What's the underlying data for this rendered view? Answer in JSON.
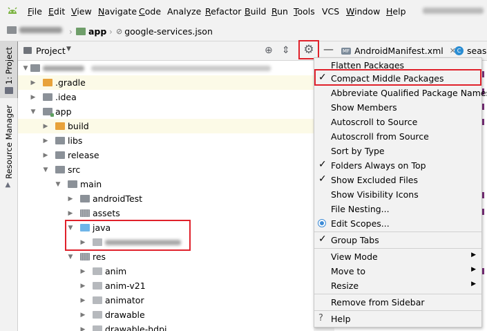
{
  "menubar": {
    "items": [
      {
        "label": "File",
        "u": "F",
        "rest": "ile"
      },
      {
        "label": "Edit",
        "u": "E",
        "rest": "dit"
      },
      {
        "label": "View",
        "u": "V",
        "rest": "iew"
      },
      {
        "label": "Navigate",
        "u": "N",
        "rest": "avigate"
      },
      {
        "label": "Code",
        "u": "C",
        "rest": "ode"
      },
      {
        "label": "Analyze",
        "u": "",
        "rest": "Analyze"
      },
      {
        "label": "Refactor",
        "u": "R",
        "rest": "efactor"
      },
      {
        "label": "Build",
        "u": "B",
        "rest": "uild"
      },
      {
        "label": "Run",
        "u": "R",
        "rest": "un"
      },
      {
        "label": "Tools",
        "u": "T",
        "rest": "ools"
      },
      {
        "label": "VCS",
        "u": "",
        "rest": "VCS"
      },
      {
        "label": "Window",
        "u": "W",
        "rest": "indow"
      },
      {
        "label": "Help",
        "u": "H",
        "rest": "elp"
      }
    ]
  },
  "breadcrumb": {
    "module": "app",
    "file": "google-services.json"
  },
  "sidebar": {
    "project_tab": "1: Project",
    "resource_tab": "Resource Manager"
  },
  "project_panel": {
    "title": "Project"
  },
  "editor_tabs": [
    {
      "label": "AndroidManifest.xml",
      "badge": "MF"
    },
    {
      "label": "seaso",
      "badge": "C"
    }
  ],
  "tree": {
    "rows": [
      {
        "label": "",
        "blurred": true
      },
      {
        "label": ".gradle"
      },
      {
        "label": ".idea"
      },
      {
        "label": "app"
      },
      {
        "label": "build"
      },
      {
        "label": "libs"
      },
      {
        "label": "release"
      },
      {
        "label": "src"
      },
      {
        "label": "main"
      },
      {
        "label": "androidTest"
      },
      {
        "label": "assets"
      },
      {
        "label": "java"
      },
      {
        "label": "",
        "blurred": true
      },
      {
        "label": "res"
      },
      {
        "label": "anim"
      },
      {
        "label": "anim-v21"
      },
      {
        "label": "animator"
      },
      {
        "label": "drawable"
      },
      {
        "label": "drawable-hdpi"
      }
    ]
  },
  "popup_menu": {
    "items": [
      {
        "label": "Flatten Packages",
        "checked": false
      },
      {
        "label": "Compact Middle Packages",
        "checked": true
      },
      {
        "label": "Abbreviate Qualified Package Names",
        "checked": false
      },
      {
        "label": "Show Members",
        "checked": false
      },
      {
        "label": "Autoscroll to Source",
        "checked": false
      },
      {
        "label": "Autoscroll from Source",
        "checked": false
      },
      {
        "label": "Sort by Type",
        "checked": false
      },
      {
        "label": "Folders Always on Top",
        "checked": true
      },
      {
        "label": "Show Excluded Files",
        "checked": true
      },
      {
        "label": "Show Visibility Icons",
        "checked": false
      },
      {
        "label": "File Nesting...",
        "checked": false
      },
      {
        "label": "Edit Scopes...",
        "checked": false
      },
      {
        "label": "Group Tabs",
        "checked": true
      },
      {
        "label": "View Mode",
        "submenu": true
      },
      {
        "label": "Move to",
        "submenu": true
      },
      {
        "label": "Resize",
        "submenu": true
      },
      {
        "label": "Remove from Sidebar"
      },
      {
        "label": "Help"
      }
    ]
  },
  "colors": {
    "highlight_box": "#e0202a",
    "folder_orange": "#e8a23a",
    "folder_blue": "#6fb5e8",
    "row_highlight": "#fcfae7"
  }
}
